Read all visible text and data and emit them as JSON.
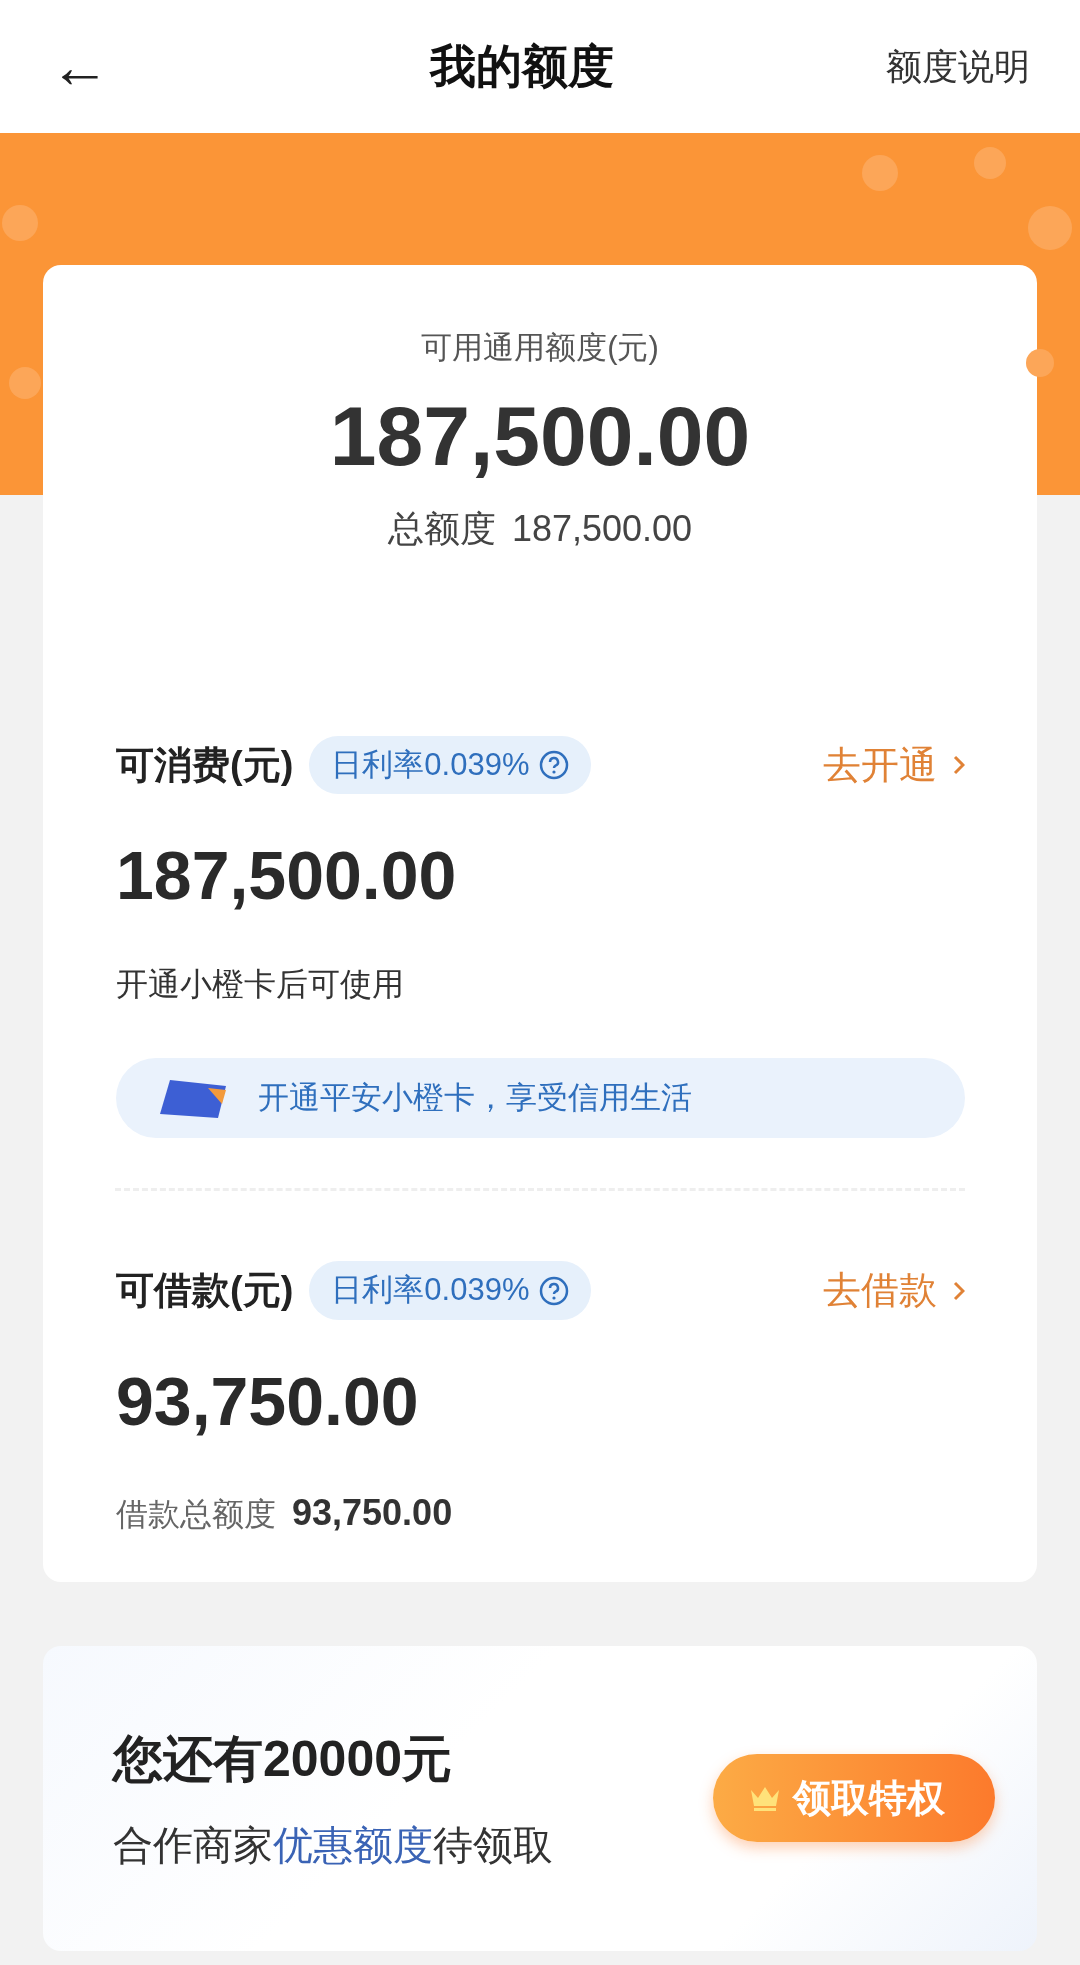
{
  "header": {
    "back": "←",
    "title": "我的额度",
    "link": "额度说明"
  },
  "summary": {
    "label": "可用通用额度(元)",
    "amount": "187,500.00",
    "total_label": "总额度",
    "total_value": "187,500.00"
  },
  "sections": [
    {
      "kind": "card",
      "title": "可消费(元)",
      "rate": "日利率0.039%",
      "action": "去开通",
      "amount": "187,500.00",
      "note": "开通小橙卡后可使用",
      "banner": "开通平安小橙卡，享受信用生活"
    },
    {
      "kind": "loan",
      "title": "可借款(元)",
      "rate": "日利率0.039%",
      "action": "去借款",
      "amount": "93,750.00",
      "total_label": "借款总额度",
      "total_value": "93,750.00"
    }
  ],
  "promo": {
    "title": "您还有20000元",
    "subtitle": [
      {
        "kind": "plain",
        "text": "合作商家"
      },
      {
        "kind": "highlight",
        "text": "优惠额度"
      },
      {
        "kind": "plain",
        "text": "待领取"
      }
    ],
    "button": "领取特权"
  }
}
